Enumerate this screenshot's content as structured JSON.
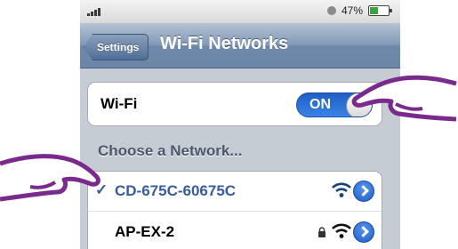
{
  "status_bar": {
    "battery_percent": "47%",
    "battery_level": 0.47,
    "battery_color": "#3ea33e"
  },
  "nav": {
    "back_label": "Settings",
    "title": "Wi-Fi Networks"
  },
  "wifi": {
    "label": "Wi-Fi",
    "toggle_state": "ON",
    "accent": "#2a6fd9"
  },
  "section": {
    "header": "Choose a Network..."
  },
  "networks": [
    {
      "name": "CD-675C-60675C",
      "selected": true,
      "secured": false,
      "check": "✓",
      "icons": [
        "wifi-icon",
        "disclosure-icon"
      ]
    },
    {
      "name": "AP-EX-2",
      "selected": false,
      "secured": true,
      "icons": [
        "lock-icon",
        "wifi-icon",
        "disclosure-icon"
      ]
    }
  ],
  "colors": {
    "nav_bar": "#6e88a9",
    "background": "#c5ccd4",
    "selected_text": "#375d9a",
    "hand_outline": "#7a2a8c"
  }
}
